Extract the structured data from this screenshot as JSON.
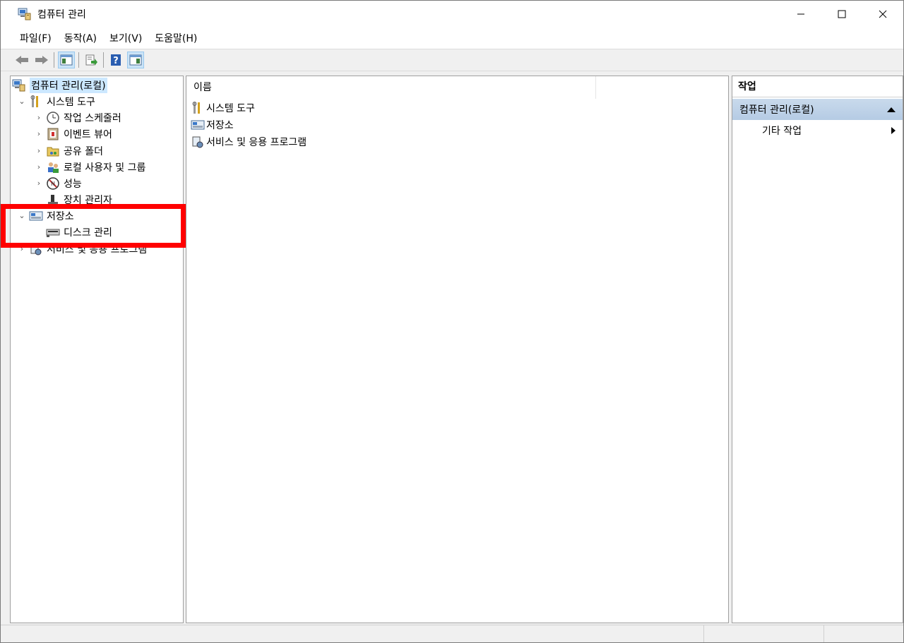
{
  "window": {
    "title": "컴퓨터 관리",
    "controls": {
      "minimize": "—",
      "maximize": "☐",
      "close": "✕"
    }
  },
  "menu": [
    {
      "label": "파일(F)"
    },
    {
      "label": "동작(A)"
    },
    {
      "label": "보기(V)"
    },
    {
      "label": "도움말(H)"
    }
  ],
  "toolbar": {
    "icons": [
      "back-arrow-icon",
      "forward-arrow-icon",
      "show-hide-tree-icon",
      "export-list-icon",
      "help-icon",
      "show-hide-action-pane-icon"
    ]
  },
  "tree": {
    "root": "컴퓨터 관리(로컬)",
    "system_tools": "시스템 도구",
    "task_scheduler": "작업 스케줄러",
    "event_viewer": "이벤트 뷰어",
    "shared_folders": "공유 폴더",
    "local_users": "로컬 사용자 및 그룹",
    "performance": "성능",
    "device_manager": "장치 관리자",
    "storage": "저장소",
    "disk_management": "디스크 관리",
    "services": "서비스 및 응용 프로그램",
    "chevron_expanded": "⌄",
    "chevron_collapsed": "›"
  },
  "center": {
    "column_name": "이름",
    "items": [
      "시스템 도구",
      "저장소",
      "서비스 및 응용 프로그램"
    ]
  },
  "actions": {
    "header": "작업",
    "section": "컴퓨터 관리(로컬)",
    "item": "기타 작업"
  },
  "colors": {
    "highlight": "#ff0000",
    "selection": "#cce8ff",
    "action_section": "#c2d6ea"
  }
}
